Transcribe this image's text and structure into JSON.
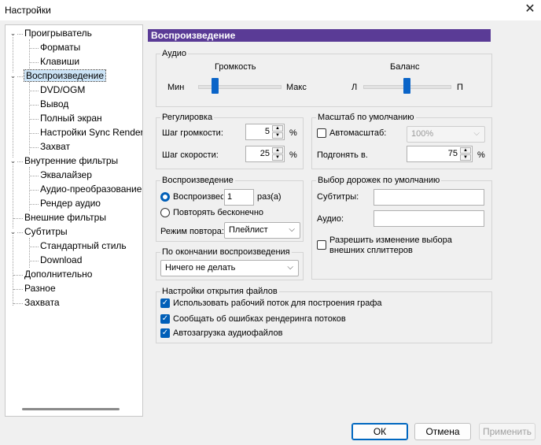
{
  "window": {
    "title": "Настройки",
    "close_icon": "close-icon"
  },
  "tree": {
    "items": [
      {
        "label": "Проигрыватель",
        "level": 0,
        "toggle": "collapse"
      },
      {
        "label": "Форматы",
        "level": 1
      },
      {
        "label": "Клавиши",
        "level": 1
      },
      {
        "label": "Воспроизведение",
        "level": 0,
        "toggle": "collapse",
        "selected": true
      },
      {
        "label": "DVD/OGM",
        "level": 1
      },
      {
        "label": "Вывод",
        "level": 1
      },
      {
        "label": "Полный экран",
        "level": 1
      },
      {
        "label": "Настройки Sync Render",
        "level": 1
      },
      {
        "label": "Захват",
        "level": 1
      },
      {
        "label": "Внутренние фильтры",
        "level": 0,
        "toggle": "collapse"
      },
      {
        "label": "Эквалайзер",
        "level": 1
      },
      {
        "label": "Аудио-преобразование",
        "level": 1
      },
      {
        "label": "Рендер аудио",
        "level": 1
      },
      {
        "label": "Внешние фильтры",
        "level": 0
      },
      {
        "label": "Субтитры",
        "level": 0,
        "toggle": "collapse"
      },
      {
        "label": "Стандартный стиль",
        "level": 1
      },
      {
        "label": "Download",
        "level": 1
      },
      {
        "label": "Дополнительно",
        "level": 0
      },
      {
        "label": "Разное",
        "level": 0
      },
      {
        "label": "Захвата",
        "level": 0
      }
    ]
  },
  "page": {
    "header": "Воспроизведение",
    "audio": {
      "group_label": "Аудио",
      "volume_label": "Громкость",
      "volume_min": "Мин",
      "volume_max": "Макс",
      "volume_level": 0.2,
      "balance_label": "Баланс",
      "balance_left": "Л",
      "balance_right": "П",
      "balance_level": 0.5
    },
    "adjust": {
      "group_label": "Регулировка",
      "volume_step_label": "Шаг громкости:",
      "volume_step_value": "5",
      "volume_step_unit": "%",
      "speed_step_label": "Шаг скорости:",
      "speed_step_value": "25",
      "speed_step_unit": "%"
    },
    "scale": {
      "group_label": "Масштаб по умолчанию",
      "autoscale_label": "Автомасштаб:",
      "autoscale_checked": false,
      "autoscale_value": "100%",
      "fit_label": "Подгонять в.",
      "fit_value": "75",
      "fit_unit": "%"
    },
    "playback": {
      "group_label": "Воспроизведение",
      "play_label": "Воспроизвести",
      "play_count": "1",
      "times_label": "раз(а)",
      "repeat_forever_label": "Повторять бесконечно",
      "mode_label": "Режим повтора:",
      "mode_value": "Плейлист"
    },
    "tracks": {
      "group_label": "Выбор дорожек по умолчанию",
      "subtitles_label": "Субтитры:",
      "subtitles_value": "",
      "audio_label": "Аудио:",
      "audio_value": "",
      "splitters_label_1": "Разрешить изменение выбора",
      "splitters_label_2": "внешних сплиттеров",
      "splitters_checked": false
    },
    "after": {
      "group_label": "По окончании воспроизведения",
      "value": "Ничего не делать"
    },
    "open": {
      "group_label": "Настройки открытия файлов",
      "opt1": "Использовать рабочий поток для построения графа",
      "opt2": "Сообщать об ошибках рендеринга потоков",
      "opt3": "Автозагрузка аудиофайлов"
    }
  },
  "buttons": {
    "ok": "ОК",
    "cancel": "Отмена",
    "apply": "Применить"
  }
}
